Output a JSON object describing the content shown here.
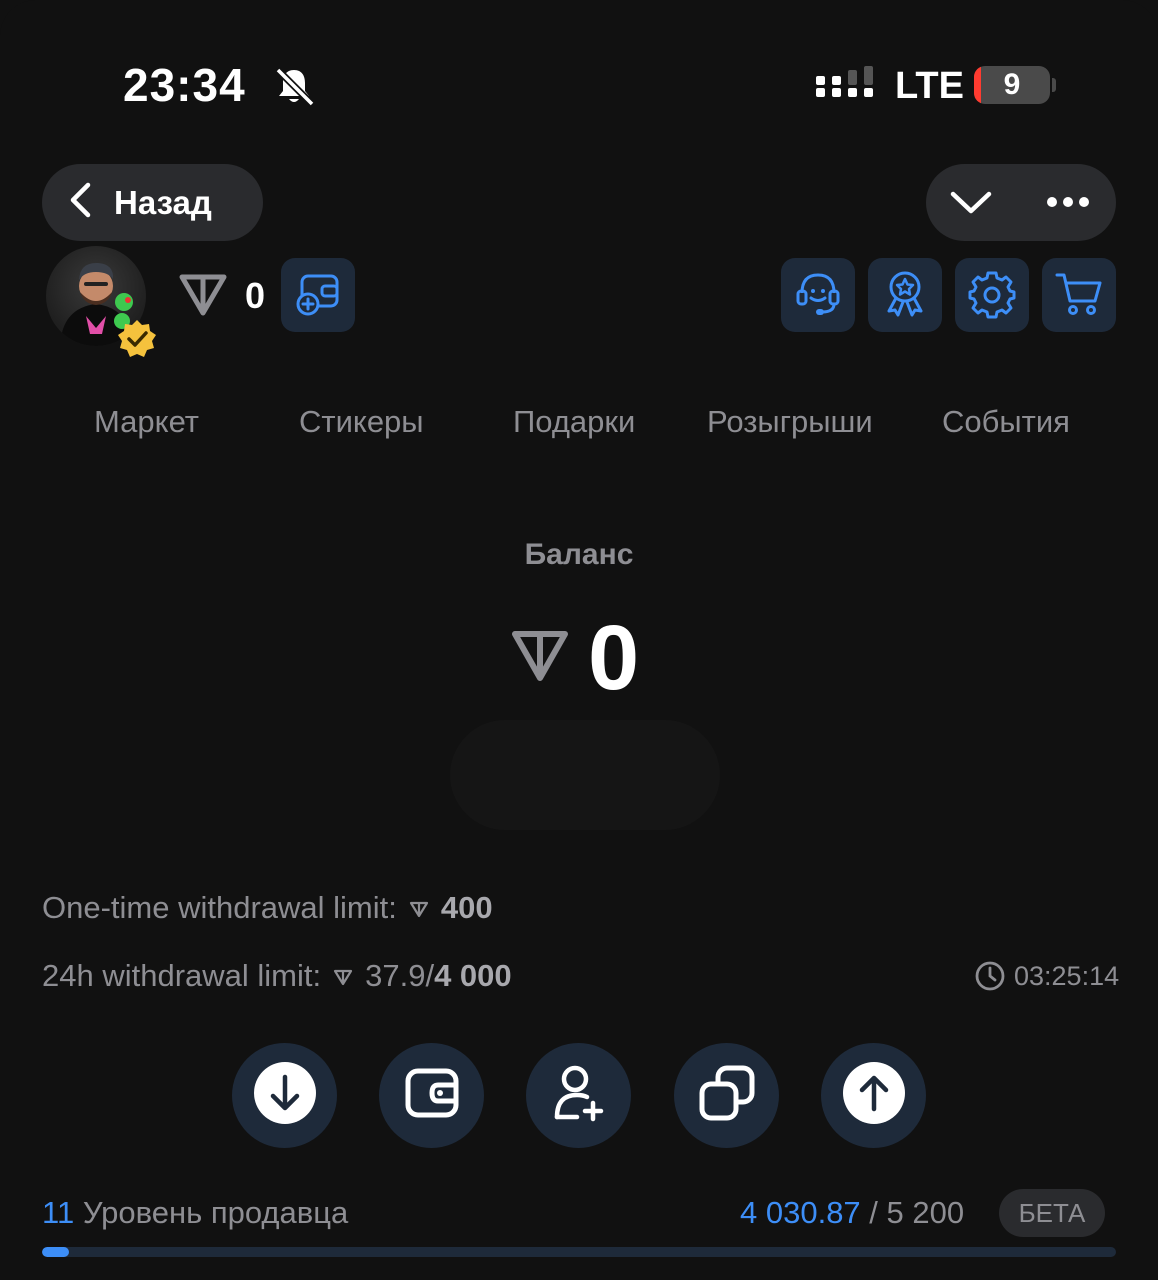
{
  "status_bar": {
    "time": "23:34",
    "network": "LTE",
    "battery": "9"
  },
  "nav": {
    "back_label": "Назад"
  },
  "header": {
    "ton_balance": "0"
  },
  "tabs": [
    "Маркет",
    "Стикеры",
    "Подарки",
    "Розыгрыши",
    "События"
  ],
  "balance": {
    "label": "Баланс",
    "value": "0"
  },
  "limits": {
    "one_time_label": "One-time withdrawal limit:",
    "one_time_value": "400",
    "daily_label": "24h withdrawal limit:",
    "daily_used": "37.9/",
    "daily_max": "4 000",
    "timer": "03:25:14"
  },
  "seller": {
    "level": "11",
    "level_label": "Уровень продавца",
    "current": "4 030.87",
    "separator": " / ",
    "target": "5 200",
    "badge": "БЕТА",
    "progress_fraction": 0.025
  },
  "colors": {
    "accent": "#3d8ef7",
    "background": "#111111",
    "button_bg": "#1e2a3a",
    "muted": "#8e8e93"
  }
}
